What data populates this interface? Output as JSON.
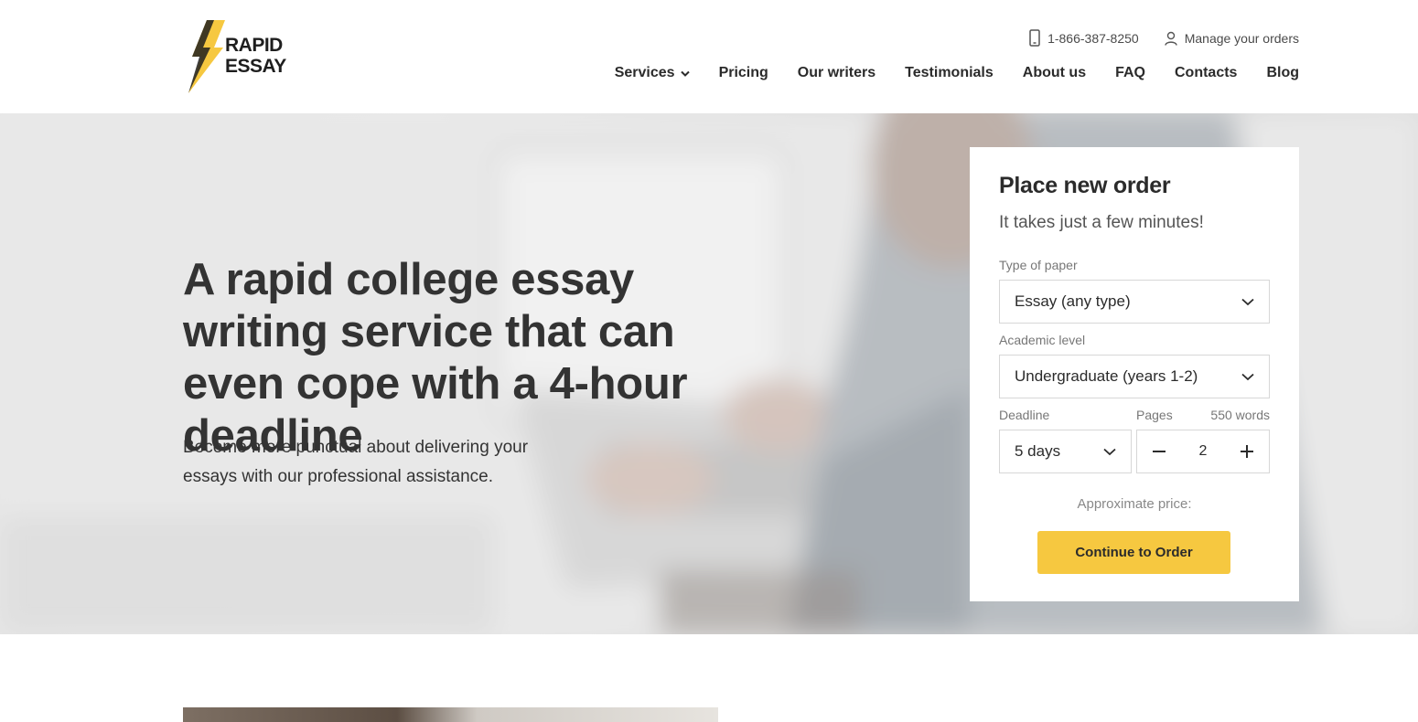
{
  "brand": {
    "logo_line1": "RAPID",
    "logo_line2": "ESSAY",
    "accent_color": "#f6c840"
  },
  "topbar": {
    "phone_icon": "phone-icon",
    "phone": "1-866-387-8250",
    "orders_icon": "user-icon",
    "orders_label": "Manage your orders"
  },
  "nav": {
    "items": [
      {
        "label": "Services",
        "has_dropdown": true
      },
      {
        "label": "Pricing"
      },
      {
        "label": "Our writers"
      },
      {
        "label": "Testimonials"
      },
      {
        "label": "About us"
      },
      {
        "label": "FAQ"
      },
      {
        "label": "Contacts"
      },
      {
        "label": "Blog"
      }
    ]
  },
  "hero": {
    "title": "A rapid college essay writing service that can even cope with a 4-hour deadline",
    "subtitle": "Become more punctual about delivering your essays with our professional assistance."
  },
  "order_form": {
    "title": "Place new order",
    "subtitle": "It takes just a few minutes!",
    "paper_type": {
      "label": "Type of paper",
      "value": "Essay (any type)"
    },
    "academic_level": {
      "label": "Academic level",
      "value": "Undergraduate (years 1-2)"
    },
    "deadline": {
      "label": "Deadline",
      "value": "5 days"
    },
    "pages": {
      "label": "Pages",
      "words": "550 words",
      "value": "2"
    },
    "price_label": "Approximate price:",
    "cta_label": "Continue to Order"
  }
}
